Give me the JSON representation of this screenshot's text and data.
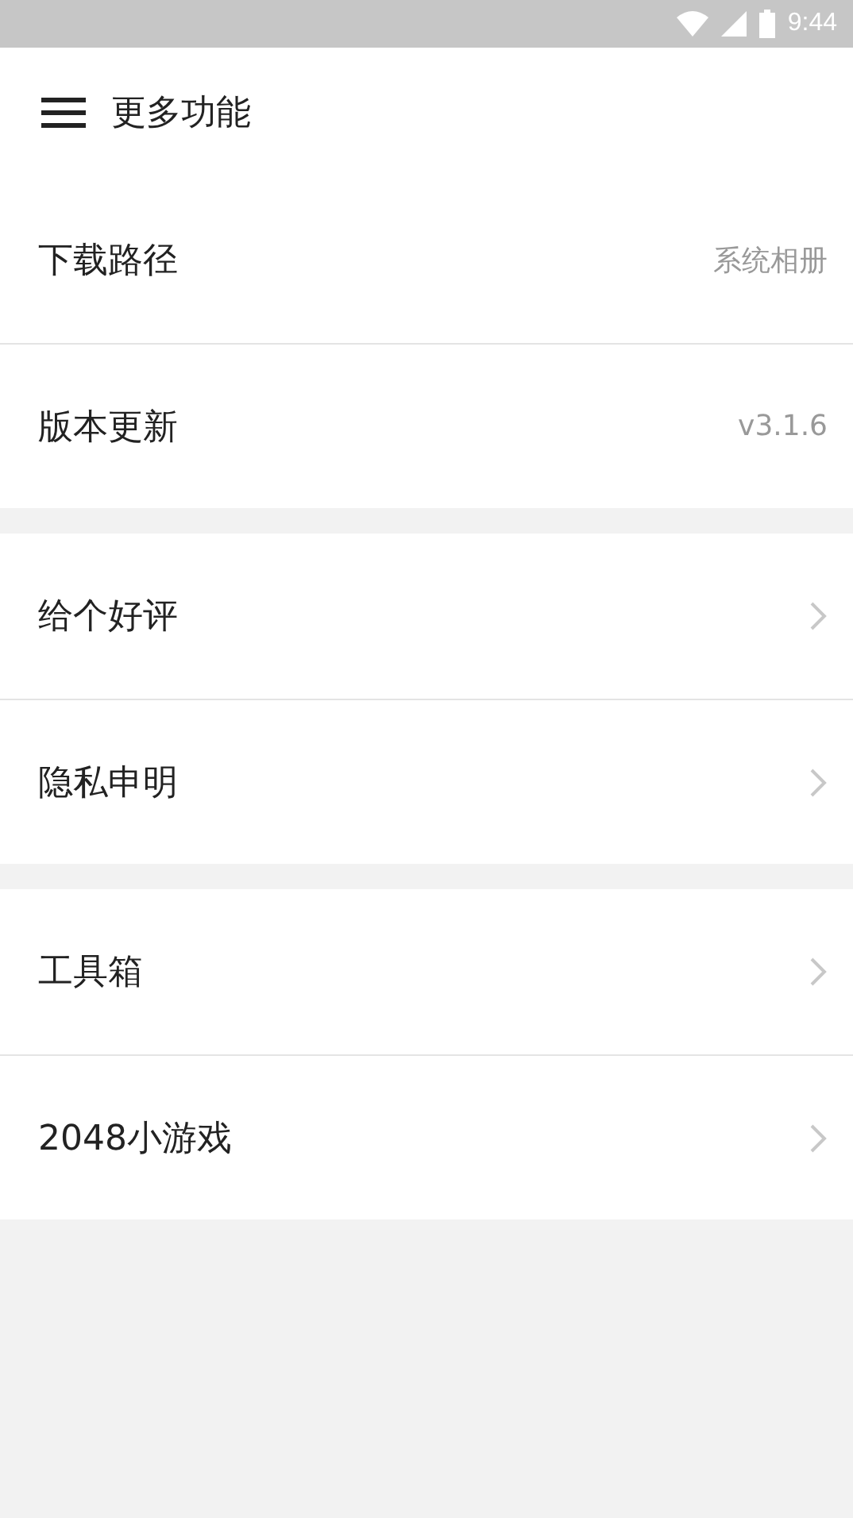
{
  "status_bar": {
    "time": "9:44"
  },
  "header": {
    "title": "更多功能"
  },
  "groups": [
    {
      "items": [
        {
          "kind": "value",
          "label": "下载路径",
          "value": "系统相册"
        },
        {
          "kind": "value",
          "label": "版本更新",
          "value": "v3.1.6"
        }
      ]
    },
    {
      "items": [
        {
          "kind": "link",
          "label": "给个好评"
        },
        {
          "kind": "link",
          "label": "隐私申明"
        }
      ]
    },
    {
      "items": [
        {
          "kind": "link",
          "label": "工具箱"
        },
        {
          "kind": "link",
          "label": "2048小游戏"
        }
      ]
    }
  ]
}
